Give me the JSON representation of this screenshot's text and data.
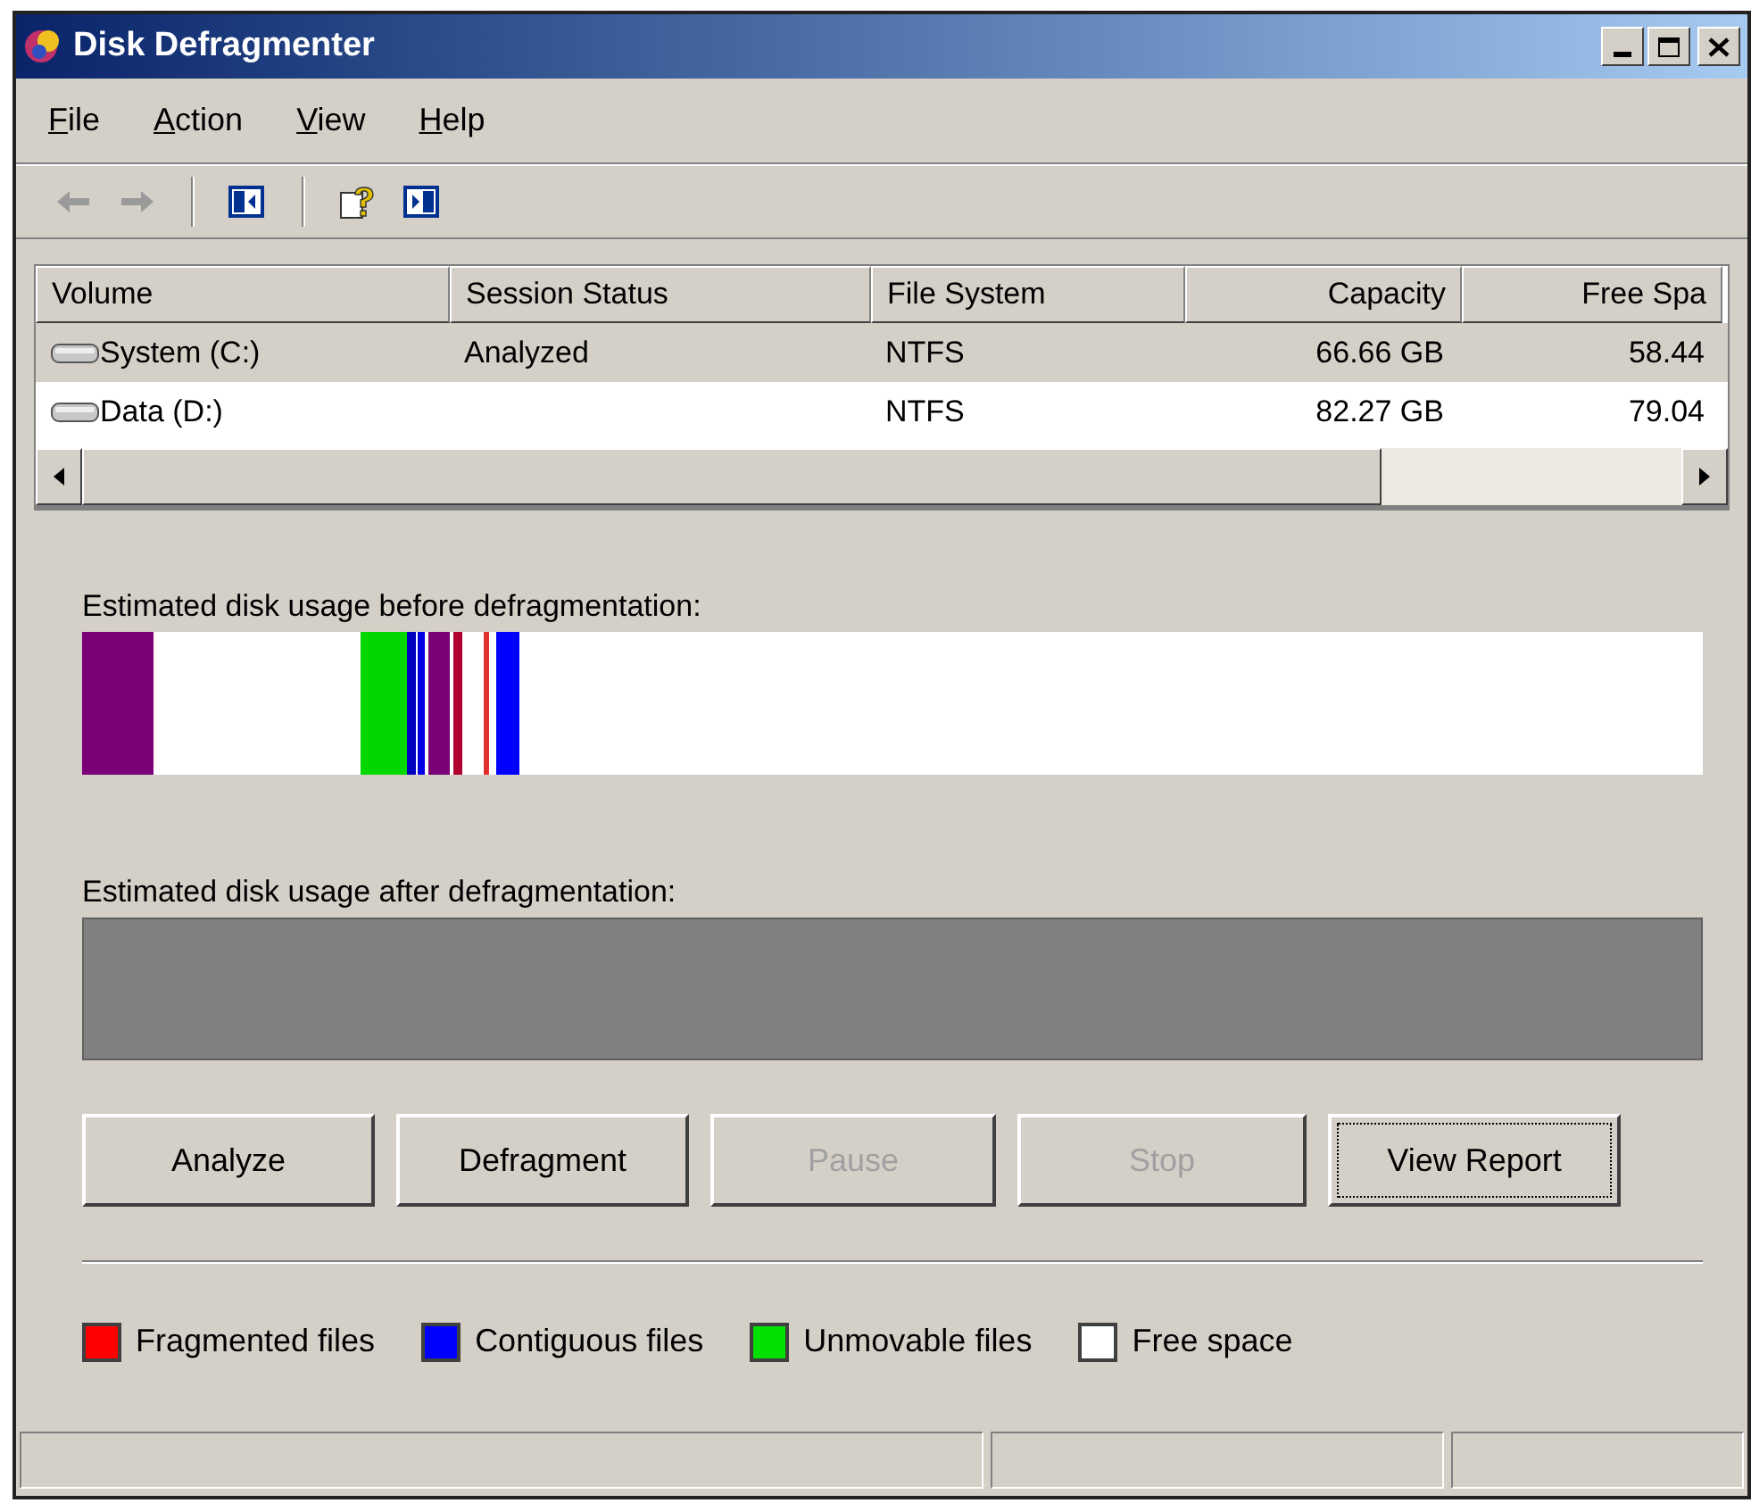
{
  "window": {
    "title": "Disk Defragmenter"
  },
  "menu": [
    {
      "label": "File"
    },
    {
      "label": "Action"
    },
    {
      "label": "View"
    },
    {
      "label": "Help"
    }
  ],
  "toolbar": [
    {
      "kind": "back",
      "disabled": true
    },
    {
      "kind": "forward",
      "disabled": true
    },
    {
      "kind": "separator"
    },
    {
      "kind": "pane-left"
    },
    {
      "kind": "separator"
    },
    {
      "kind": "help"
    },
    {
      "kind": "pane-right"
    }
  ],
  "table": {
    "columns": [
      "Volume",
      "Session Status",
      "File System",
      "Capacity",
      "Free Spa"
    ],
    "rows": [
      {
        "selected": true,
        "cells": [
          "System (C:)",
          "Analyzed",
          "NTFS",
          "66.66 GB",
          "58.44"
        ]
      },
      {
        "selected": false,
        "cells": [
          "Data (D:)",
          "",
          "NTFS",
          "82.27 GB",
          "79.04"
        ]
      }
    ]
  },
  "before_label": "Estimated disk usage before defragmentation:",
  "after_label": "Estimated disk usage after defragmentation:",
  "buttons": [
    {
      "label": "Analyze",
      "disabled": false,
      "focused": false
    },
    {
      "label": "Defragment",
      "disabled": false,
      "focused": false
    },
    {
      "label": "Pause",
      "disabled": true,
      "focused": false
    },
    {
      "label": "Stop",
      "disabled": true,
      "focused": false
    },
    {
      "label": "View Report",
      "disabled": false,
      "focused": true
    }
  ],
  "legend": [
    {
      "label": "Fragmented files",
      "color": "#ff0000"
    },
    {
      "label": "Contiguous files",
      "color": "#0000ff"
    },
    {
      "label": "Unmovable files",
      "color": "#00e000"
    },
    {
      "label": "Free space",
      "color": "#ffffff"
    }
  ]
}
